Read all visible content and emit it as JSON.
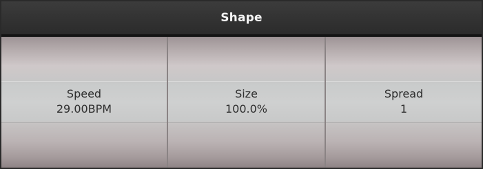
{
  "panel": {
    "title": "Shape",
    "cells": [
      {
        "label": "Speed",
        "value": "29.00BPM"
      },
      {
        "label": "Size",
        "value": "100.0%"
      },
      {
        "label": "Spread",
        "value": "1"
      }
    ]
  },
  "colors": {
    "title_bar": "#333333",
    "title_text": "#f4f4f4",
    "cell_text": "#2e2e2e",
    "cell_divider": "#8a8384"
  }
}
